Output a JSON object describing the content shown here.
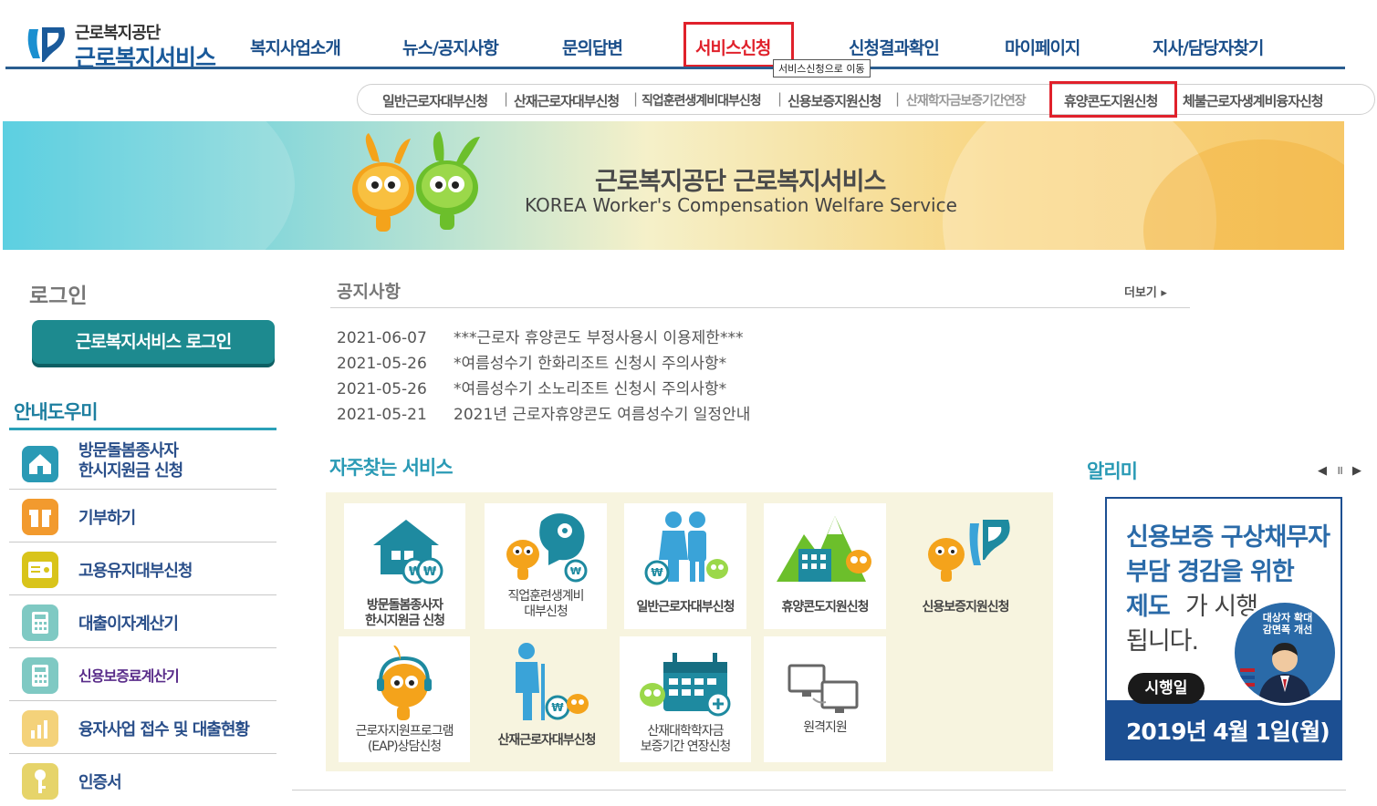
{
  "header": {
    "logo_small": "근로복지공단",
    "logo_big": "근로복지서비스",
    "nav": [
      "복지사업소개",
      "뉴스/공지사항",
      "문의답변",
      "서비스신청",
      "신청결과확인",
      "마이페이지",
      "지사/담당자찾기"
    ],
    "tooltip": "서비스신청으로 이동"
  },
  "subnav": [
    "일반근로자대부신청",
    "산재근로자대부신청",
    "직업훈련생계비대부신청",
    "신용보증지원신청",
    "산재학자금보증기간연장",
    "휴양콘도지원신청",
    "체불근로자생계비융자신청"
  ],
  "banner": {
    "title": "근로복지공단 근로복지서비스",
    "subtitle": "KOREA Worker's Compensation Welfare Service"
  },
  "login": {
    "heading": "로그인",
    "button": "근로복지서비스 로그인"
  },
  "guide": {
    "heading": "안내도우미",
    "items": [
      {
        "label": "방문돌봄종사자\n한시지원금 신청",
        "icon": "house-icon"
      },
      {
        "label": "기부하기",
        "icon": "gift-icon"
      },
      {
        "label": "고용유지대부신청",
        "icon": "id-card-icon"
      },
      {
        "label": "대출이자계산기",
        "icon": "calculator-icon"
      },
      {
        "label": "신용보증료계산기",
        "icon": "calculator-icon"
      },
      {
        "label": "융자사업 접수 및 대출현황",
        "icon": "bar-chart-icon"
      },
      {
        "label": "인증서",
        "icon": "key-icon"
      }
    ]
  },
  "notice": {
    "heading": "공지사항",
    "more": "더보기 ▸",
    "items": [
      {
        "date": "2021-06-07",
        "title": "***근로자 휴양콘도 부정사용시 이용제한***"
      },
      {
        "date": "2021-05-26",
        "title": "*여름성수기 한화리조트 신청시 주의사항*"
      },
      {
        "date": "2021-05-26",
        "title": "*여름성수기 소노리조트 신청시 주의사항*"
      },
      {
        "date": "2021-05-21",
        "title": "2021년 근로자휴양콘도 여름성수기 일정안내"
      }
    ]
  },
  "frequent": {
    "heading": "자주찾는 서비스",
    "tiles": [
      {
        "label": "방문돌봄종사자\n한시지원금 신청",
        "icon": "house-coin-icon"
      },
      {
        "label": "직업훈련생계비\n대부신청",
        "icon": "mascot-brain-icon"
      },
      {
        "label": "일반근로자대부신청",
        "icon": "people-coin-icon"
      },
      {
        "label": "휴양콘도지원신청",
        "icon": "mountain-building-icon"
      },
      {
        "label": "신용보증지원신청",
        "icon": "mascot-logo-icon"
      },
      {
        "label": "근로자지원프로그램\n(EAP)상담신청",
        "icon": "mascot-headset-icon"
      },
      {
        "label": "산재근로자대부신청",
        "icon": "crutch-person-icon"
      },
      {
        "label": "산재대학학자금\n보증기간 연장신청",
        "icon": "calendar-icon"
      },
      {
        "label": "원격지원",
        "icon": "monitors-icon"
      }
    ]
  },
  "alimi": {
    "heading": "알리미",
    "controls": "◀ ॥ ▶",
    "line1": "신용보증 구상채무자",
    "line2": "부담 경감을 위한",
    "line3a": "제도",
    "line3b": "가 시행",
    "line4": "됩니다.",
    "badge": "대상자 확대\n감면폭 개선",
    "date_label": "시행일",
    "date": "2019년 4월 1일(월)"
  }
}
